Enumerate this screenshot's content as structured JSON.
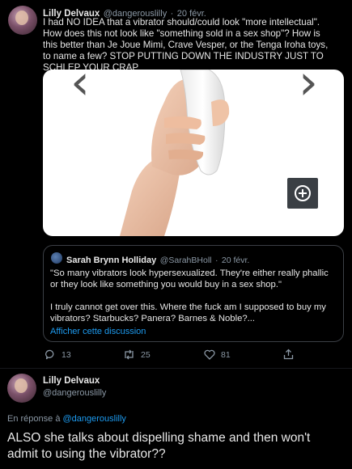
{
  "tweet1": {
    "author_name": "Lilly Delvaux",
    "author_handle": "@dangerouslilly",
    "dot": "·",
    "date": "20 févr.",
    "text": "I had NO IDEA that a vibrator should/could look \"more intellectual\". How does this not look like \"something sold in a sex shop\"? How is this better than Je Joue Mimi, Crave Vesper, or the Tenga Iroha toys, to name a few? STOP PUTTING DOWN THE INDUSTRY JUST TO SCHLEP YOUR CRAP",
    "media": {
      "prev_glyph": "‹",
      "next_glyph": "›",
      "expand_icon": "plus-circle-icon"
    },
    "quote": {
      "author_name": "Sarah Brynn Holliday",
      "author_handle": "@SarahBHoll",
      "dot": "·",
      "date": "20 févr.",
      "text_1": "\"So many vibrators look hypersexualized. They're either really phallic or they look like something you would buy in a sex shop.\"",
      "text_2": "I truly cannot get over this. Where the fuck am I supposed to buy my vibrators? Starbucks? Panera? Barnes & Noble?...",
      "show_thread": "Afficher cette discussion"
    },
    "actions": {
      "reply_count": "13",
      "retweet_count": "25",
      "like_count": "81"
    }
  },
  "tweet2": {
    "author_name": "Lilly Delvaux",
    "author_handle": "@dangerouslilly",
    "reply_prefix": "En réponse à",
    "reply_to": "@dangerouslilly",
    "text": "ALSO she talks about dispelling shame and then won't admit to using the vibrator??"
  },
  "colors": {
    "background": "#000000",
    "link": "#1d9bf0",
    "muted": "#8b98a5",
    "border": "#3b3f45"
  }
}
